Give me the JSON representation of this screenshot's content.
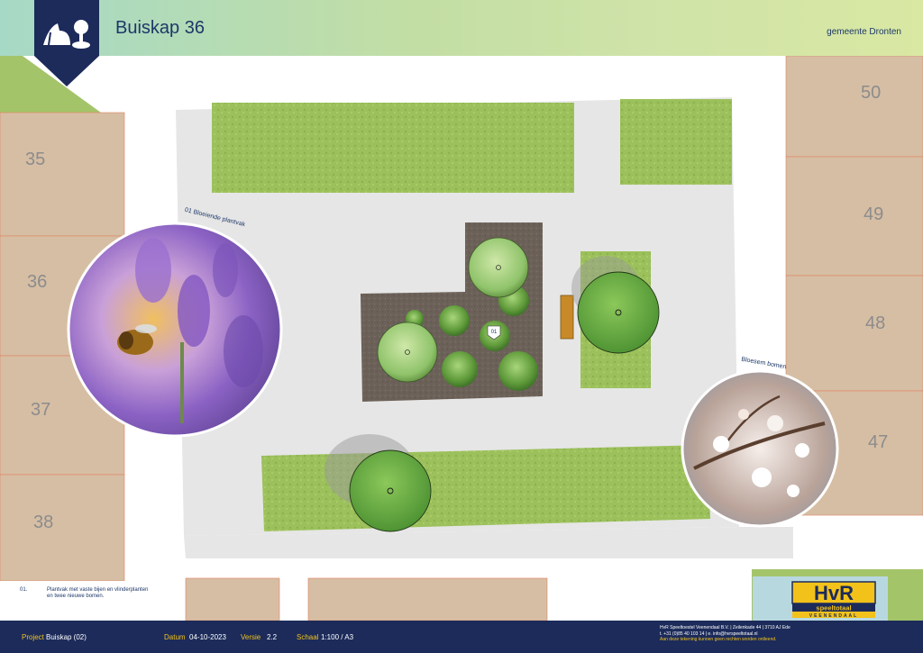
{
  "header": {
    "title": "Buiskap 36",
    "client": "gemeente Dronten",
    "logo_icon": "playground-icon"
  },
  "lots": [
    {
      "number": "35"
    },
    {
      "number": "36"
    },
    {
      "number": "37"
    },
    {
      "number": "38"
    },
    {
      "number": "50"
    },
    {
      "number": "49"
    },
    {
      "number": "48"
    },
    {
      "number": "47"
    }
  ],
  "callouts": {
    "lavender": {
      "label": "01 Bloeiende plantvak",
      "icon": "lavender-bee-photo"
    },
    "blossom": {
      "label": "Bloesem bomen",
      "icon": "blossom-branch-photo"
    }
  },
  "marker": {
    "label": "01"
  },
  "legend": {
    "number": "01.",
    "text": "Plantvak met vaste bijen en vlinderplanten en twee nieuwe bomen."
  },
  "footer": {
    "project_label": "Project",
    "project_value": "Buiskap (02)",
    "date_label": "Datum",
    "date_value": "04-10-2023",
    "version_label": "Versie",
    "version_value": "2.2",
    "scale_label": "Schaal",
    "scale_value": "1:100  /  A3",
    "company_line1": "HvR Speeltoestel Veenendaal B.V.  |  Zeilenkade 44  |  3710 AJ Ede",
    "company_line2": "t. +31 (0)85 40 103 14  |  e. info@hvrspeeltotaal.nl",
    "disclaimer": "Aan deze tekening kunnen geen rechten worden ontleend."
  },
  "brand_logo": {
    "line1": "HvR",
    "line2": "speeltotaal",
    "line3": "VEENENDAAL"
  },
  "colors": {
    "navy": "#1c2b5a",
    "yellow": "#f2c21b",
    "lot_tan": "#d6bea4",
    "lawn_green": "#9ac05a",
    "paving": "#e6e6e6"
  }
}
